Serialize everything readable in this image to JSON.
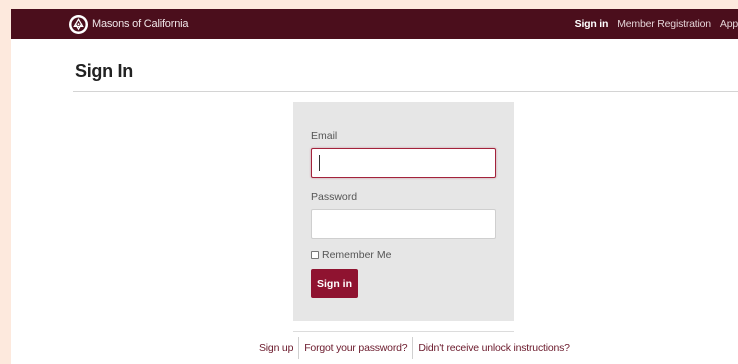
{
  "brand": {
    "name": "Masons of California",
    "logo_icon": "masonic-square-compass-icon"
  },
  "nav": {
    "items": [
      {
        "label": "Sign in",
        "active": true
      },
      {
        "label": "Member Registration",
        "active": false
      },
      {
        "label": "App",
        "active": false
      }
    ]
  },
  "page": {
    "title": "Sign In"
  },
  "form": {
    "email_label": "Email",
    "email_value": "",
    "password_label": "Password",
    "password_value": "",
    "remember_label": "Remember Me",
    "remember_checked": false,
    "submit_label": "Sign in"
  },
  "footer": {
    "links": [
      "Sign up",
      "Forgot your password?",
      "Didn't receive unlock instructions?"
    ]
  },
  "colors": {
    "topbar": "#4b0e1c",
    "button": "#8f1330",
    "focus_border": "#a3223b",
    "outer_background": "#fde9dd",
    "card_background": "#e6e6e6"
  }
}
